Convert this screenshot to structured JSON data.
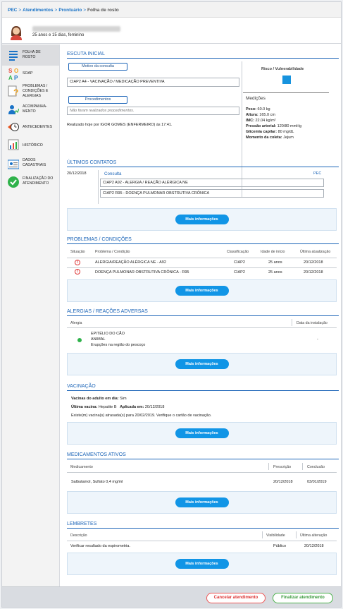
{
  "breadcrumb": {
    "items": [
      "PEC",
      "Atendimentos",
      "Prontuário"
    ],
    "current": "Folha de rosto",
    "sep": ">"
  },
  "patient": {
    "age": "25 anos e 15 dias, feminino"
  },
  "sidebar": {
    "items": [
      {
        "label": "FOLHA DE ROSTO",
        "icon": "document-lines-icon"
      },
      {
        "label": "SOAP",
        "icon": "soap-icon"
      },
      {
        "label": "PROBLEMAS / CONDIÇÕES E ALERGIAS",
        "icon": "question-document-icon"
      },
      {
        "label": "ACOMPANHA-MENTO",
        "icon": "person-chart-icon"
      },
      {
        "label": "ANTECEDENTES",
        "icon": "clock-history-icon"
      },
      {
        "label": "HISTÓRICO",
        "icon": "history-chart-icon"
      },
      {
        "label": "DADOS CADASTRAIS",
        "icon": "id-card-icon"
      },
      {
        "label": "FINALIZAÇÃO DO ATENDIMENTO",
        "icon": "check-circle-icon"
      }
    ]
  },
  "escuta": {
    "title": "ESCUTA INICIAL",
    "motivo_label": "Motivo da consulta",
    "motivo_value": "CIAP2 A4 - VACINAÇÃO / MEDICAÇÃO PREVENTIVA",
    "proced_label": "Procedimentos",
    "proced_value": "Não foram realizados procedimentos.",
    "realizado": "Realizado hoje por IGOR GOMES (ENFERMEIRO) às 17:41.",
    "risco_title": "Risco / Vulnerabilidade",
    "risco_color": "#1793de",
    "medicoes_title": "Medições",
    "medicoes": [
      {
        "label": "Peso:",
        "value": "60.0 kg"
      },
      {
        "label": "Altura:",
        "value": "165.0 cm"
      },
      {
        "label": "IMC:",
        "value": "22.04 kg/m²"
      },
      {
        "label": "Pressão arterial:",
        "value": "120/80 mmHg"
      },
      {
        "label": "Glicemia capilar:",
        "value": "80 mg/dL"
      },
      {
        "label": "Momento da coleta:",
        "value": "Jejum"
      }
    ]
  },
  "contatos": {
    "title": "ÚLTIMOS CONTATOS",
    "date": "20/12/2018",
    "consulta": "Consulta",
    "source": "PEC",
    "items": [
      "CIAP2 A92 - ALERGIA / REAÇÃO ALÉRGICA NE",
      "CIAP2 R95 - DOENÇA PULMONAR OBSTRUTIVA CRÔNICA"
    ],
    "more": "Mais informações"
  },
  "problemas": {
    "title": "PROBLEMAS / CONDIÇÕES",
    "headers": [
      "Situação",
      "Problema / Condição",
      "Classificação",
      "Idade de início",
      "Última atualização"
    ],
    "rows": [
      {
        "name": "ALERGIA/REAÇÃO ALÉRGICA NE - A92",
        "class": "CIAP2",
        "idade": "25 anos",
        "data": "20/12/2018"
      },
      {
        "name": "DOENÇA PULMONAR OBSTRUTIVA CRÔNICA - R95",
        "class": "CIAP2",
        "idade": "25 anos",
        "data": "20/12/2018"
      }
    ],
    "warn_glyph": "!",
    "more": "Mais informações"
  },
  "alergias": {
    "title": "ALERGIAS / REAÇÕES ADVERSAS",
    "headers": [
      "Alergia",
      "Data da instalação"
    ],
    "item": {
      "name": "EPITÉLIO DO CÃO",
      "type": "ANIMAL",
      "desc": "Erupções na região do pescoço",
      "date": "-"
    },
    "status_color": "#2fb24b",
    "more": "Mais informações"
  },
  "vacinacao": {
    "title": "VACINAÇÃO",
    "line1_label": "Vacinas do adulto em dia:",
    "line1_value": "Sim",
    "ultima_label": "Última vacina:",
    "ultima_value": "Hepatite B",
    "aplicada_label": "Aplicada em:",
    "aplicada_value": "20/12/2018",
    "aviso": "Existe(m) vacina(s) atrasada(s) para 20/02/2019. Verifique o cartão de vacinação.",
    "more": "Mais informações"
  },
  "medicamentos": {
    "title": "MEDICAMENTOS ATIVOS",
    "headers": [
      "Medicamento",
      "Prescrição",
      "Conclusão"
    ],
    "rows": [
      {
        "name": "Salbutamol, Sulfato 0,4 mg/ml",
        "presc": "20/12/2018",
        "conc": "03/01/2019"
      }
    ],
    "more": "Mais informações"
  },
  "lembretes": {
    "title": "LEMBRETES",
    "headers": [
      "Descrição",
      "Visibilidade",
      "Última alteração"
    ],
    "rows": [
      {
        "desc": "Verificar resultado da espirometria.",
        "vis": "Público",
        "data": "20/12/2018"
      }
    ],
    "more": "Mais informações"
  },
  "footer": {
    "cancel": "Cancelar atendimento",
    "finish": "Finalizar atendimento"
  }
}
